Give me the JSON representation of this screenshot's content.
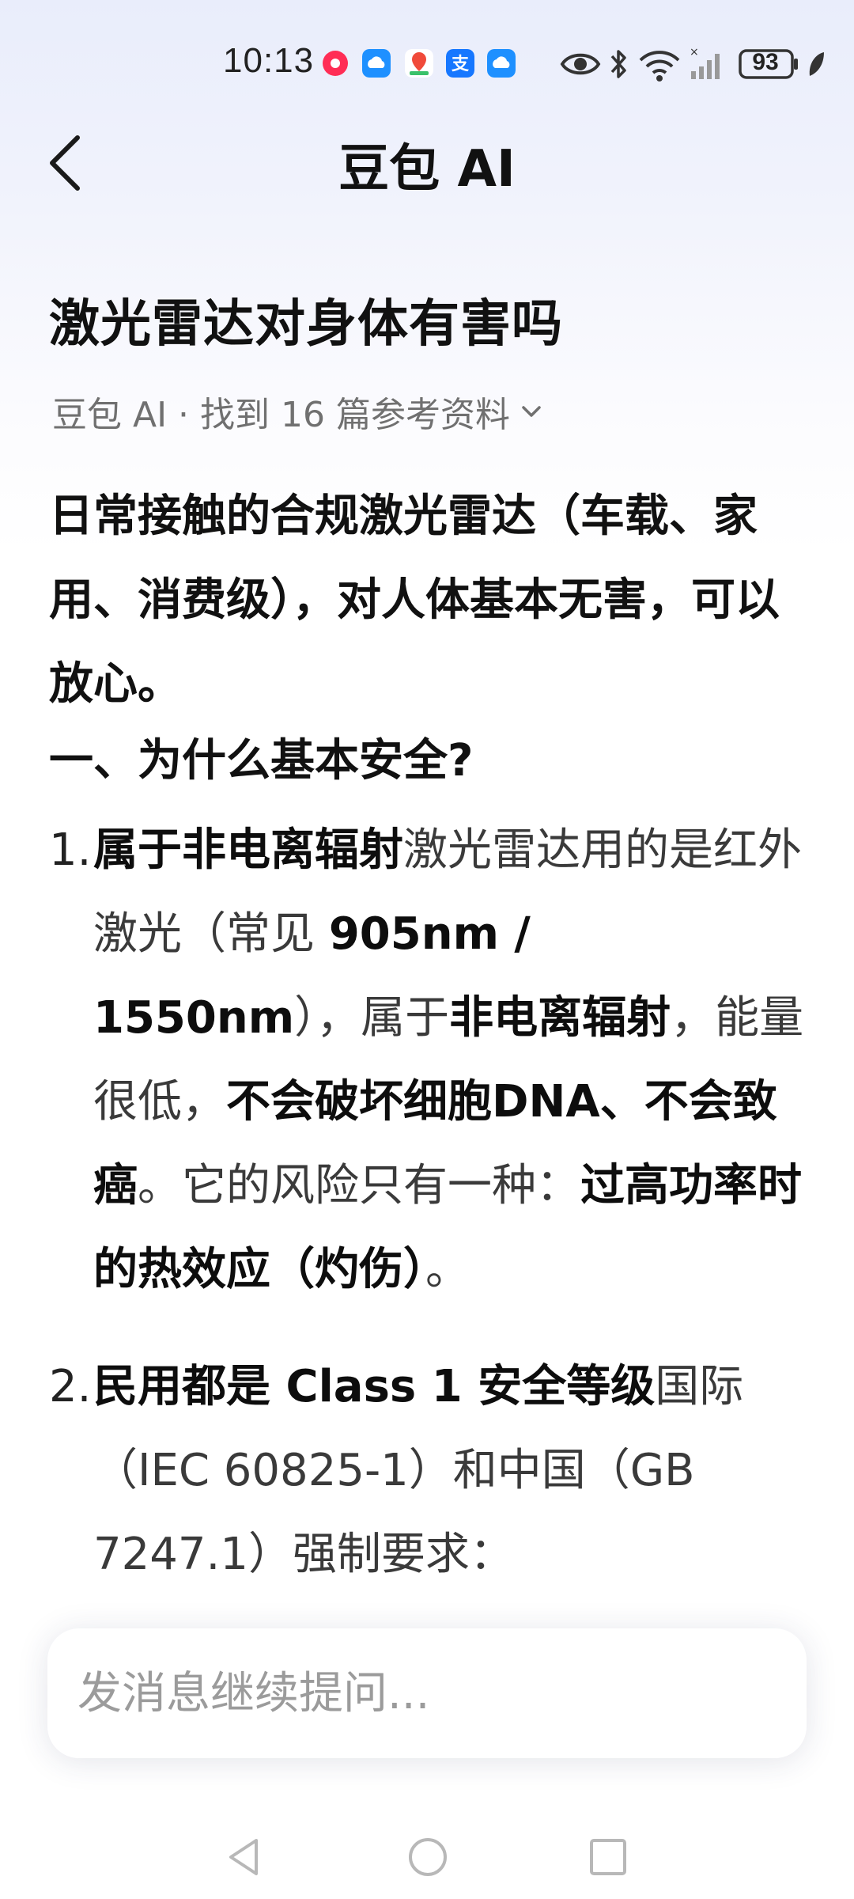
{
  "status_bar": {
    "time": "10:13",
    "battery": "93",
    "app_icons": [
      "red-app-icon",
      "cloud-app-icon",
      "map-pin-app-icon",
      "alipay-app-icon",
      "cloud-app-icon"
    ],
    "system_icons": [
      "eye-icon",
      "bluetooth-icon",
      "wifi-icon",
      "signal-icon",
      "battery-icon",
      "leaf-icon"
    ]
  },
  "header": {
    "title": "豆包 AI"
  },
  "conversation": {
    "question": "激光雷达对身体有害吗",
    "source": "豆包 AI · 找到 16 篇参考资料",
    "summary": "日常接触的合规激光雷达（车载、家用、消费级），对人体基本无害，可以放心。",
    "section_heading": "一、为什么基本安全?",
    "items": [
      {
        "num": "1.",
        "parts": [
          {
            "t": "属于非电离辐射",
            "b": true
          },
          {
            "t": "激光雷达用的是红外激光（常见 ",
            "b": false
          },
          {
            "t": "905nm / 1550nm",
            "b": true
          },
          {
            "t": "），属于",
            "b": false
          },
          {
            "t": "非电离辐射",
            "b": true
          },
          {
            "t": "，能量很低，",
            "b": false
          },
          {
            "t": "不会破坏细胞DNA、不会致癌",
            "b": true
          },
          {
            "t": "。它的风险只有一种：",
            "b": false
          },
          {
            "t": "过高功率时的热效应（灼伤）",
            "b": true
          },
          {
            "t": "。",
            "b": false
          }
        ]
      },
      {
        "num": "2.",
        "parts": [
          {
            "t": "民用都是 Class 1 安全等级",
            "b": true
          },
          {
            "t": "国际（IEC 60825-1）和中国（GB 7247.1）强制要求：",
            "b": false
          }
        ]
      }
    ]
  },
  "input": {
    "placeholder": "发消息继续提问..."
  },
  "navbar": {
    "buttons": [
      "back-nav",
      "home-nav",
      "recents-nav"
    ]
  }
}
